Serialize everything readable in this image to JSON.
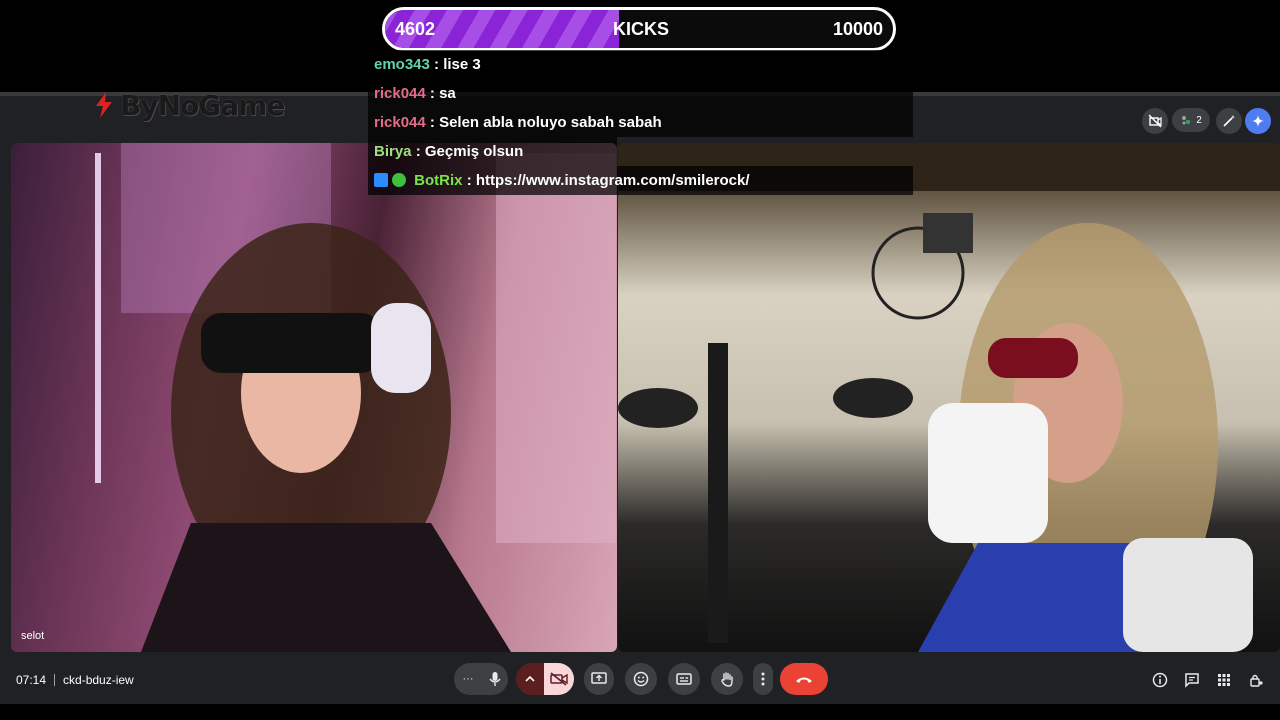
{
  "kicks": {
    "current": "4602",
    "label": "KICKS",
    "goal": "10000",
    "progress_fraction": 0.4602
  },
  "overlay_logo": {
    "text": "ByNoGame"
  },
  "chat": [
    {
      "user": "emo343",
      "message": "lise 3",
      "user_color": "#5fd3b1"
    },
    {
      "user": "rick044",
      "message": "sa",
      "user_color": "#e46c8b"
    },
    {
      "user": "rick044",
      "message": "Selen abla noluyo sabah sabah",
      "user_color": "#e46c8b"
    },
    {
      "user": "Birya",
      "message": "Geçmiş olsun",
      "user_color": "#9ee07a"
    },
    {
      "user": "BotRix",
      "message": "https://www.instagram.com/smilerock/",
      "user_color": "#7be34c"
    }
  ],
  "chat_separator": ":",
  "meet": {
    "participant_count": "2",
    "tiles": [
      {
        "name": "selot"
      },
      {
        "name": ""
      }
    ],
    "time": "07:14",
    "meeting_code": "ckd-bduz-iew",
    "toolbar_more": "···"
  },
  "colors": {
    "accent_purple": "#8a24d6",
    "leave_red": "#ea4335",
    "meet_bg": "#202124",
    "button_bg": "#3c4043"
  }
}
